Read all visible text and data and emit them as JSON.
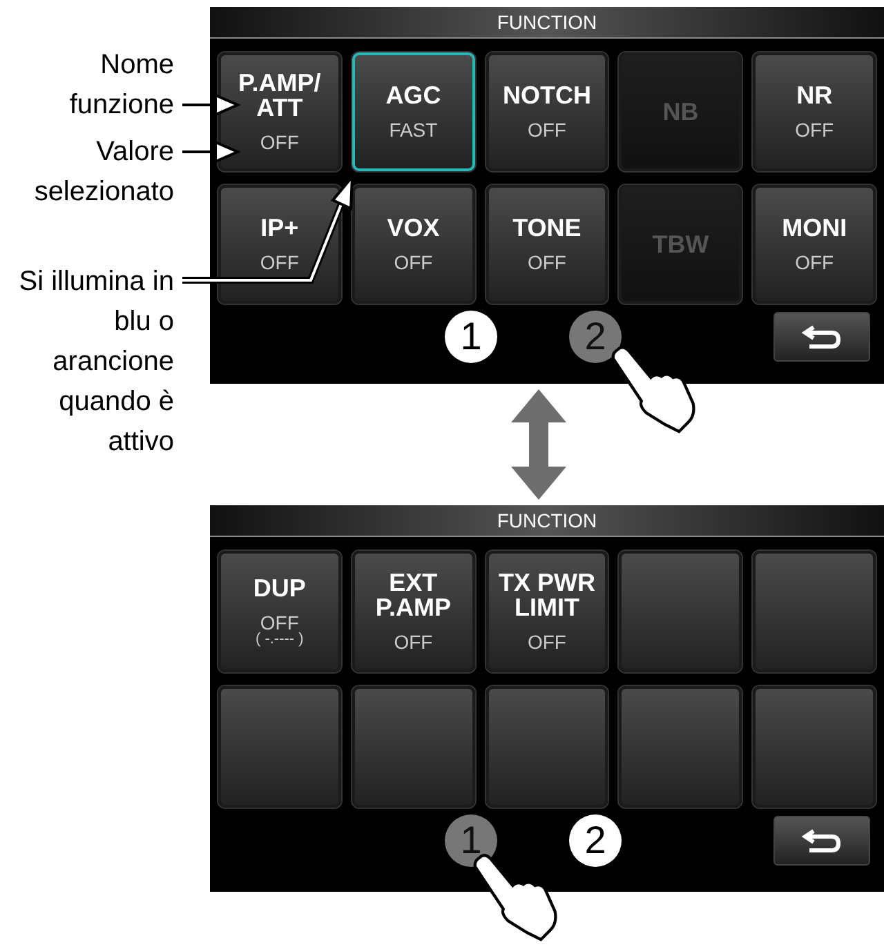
{
  "annotations": [
    "Nome funzione",
    "Valore selezionato",
    "Si illumina in blu o arancione quando è attivo"
  ],
  "screens": [
    {
      "title": "FUNCTION",
      "buttons": [
        {
          "kind": "function",
          "label": [
            "P.AMP/",
            "ATT"
          ],
          "value": "OFF",
          "highlighted": false,
          "disabled": false
        },
        {
          "kind": "function",
          "label": [
            "AGC"
          ],
          "value": "FAST",
          "highlighted": true,
          "disabled": false
        },
        {
          "kind": "function",
          "label": [
            "NOTCH"
          ],
          "value": "OFF",
          "highlighted": false,
          "disabled": false
        },
        {
          "kind": "function",
          "label": [
            "NB"
          ],
          "highlighted": false,
          "disabled": true
        },
        {
          "kind": "function",
          "label": [
            "NR"
          ],
          "value": "OFF",
          "highlighted": false,
          "disabled": false
        },
        {
          "kind": "function",
          "label": [
            "IP+"
          ],
          "value": "OFF",
          "highlighted": false,
          "disabled": false
        },
        {
          "kind": "function",
          "label": [
            "VOX"
          ],
          "value": "OFF",
          "highlighted": false,
          "disabled": false
        },
        {
          "kind": "function",
          "label": [
            "TONE"
          ],
          "value": "OFF",
          "highlighted": false,
          "disabled": false
        },
        {
          "kind": "function",
          "label": [
            "TBW"
          ],
          "highlighted": false,
          "disabled": true
        },
        {
          "kind": "function",
          "label": [
            "MONI"
          ],
          "value": "OFF",
          "highlighted": false,
          "disabled": false
        }
      ],
      "pages": [
        {
          "label": "1",
          "pressed": false
        },
        {
          "label": "2",
          "pressed": true
        }
      ]
    },
    {
      "title": "FUNCTION",
      "buttons": [
        {
          "kind": "function",
          "label": [
            "DUP"
          ],
          "value": "OFF",
          "sub_value": "( -.---- )",
          "highlighted": false,
          "disabled": false
        },
        {
          "kind": "function",
          "label": [
            "EXT",
            "P.AMP"
          ],
          "value": "OFF",
          "highlighted": false,
          "disabled": false
        },
        {
          "kind": "function",
          "label": [
            "TX PWR",
            "LIMIT"
          ],
          "value": "OFF",
          "highlighted": false,
          "disabled": false
        },
        {
          "kind": "empty"
        },
        {
          "kind": "empty"
        },
        {
          "kind": "empty"
        },
        {
          "kind": "empty"
        },
        {
          "kind": "empty"
        },
        {
          "kind": "empty"
        },
        {
          "kind": "empty"
        }
      ],
      "pages": [
        {
          "label": "1",
          "pressed": true
        },
        {
          "label": "2",
          "pressed": false
        }
      ]
    }
  ]
}
